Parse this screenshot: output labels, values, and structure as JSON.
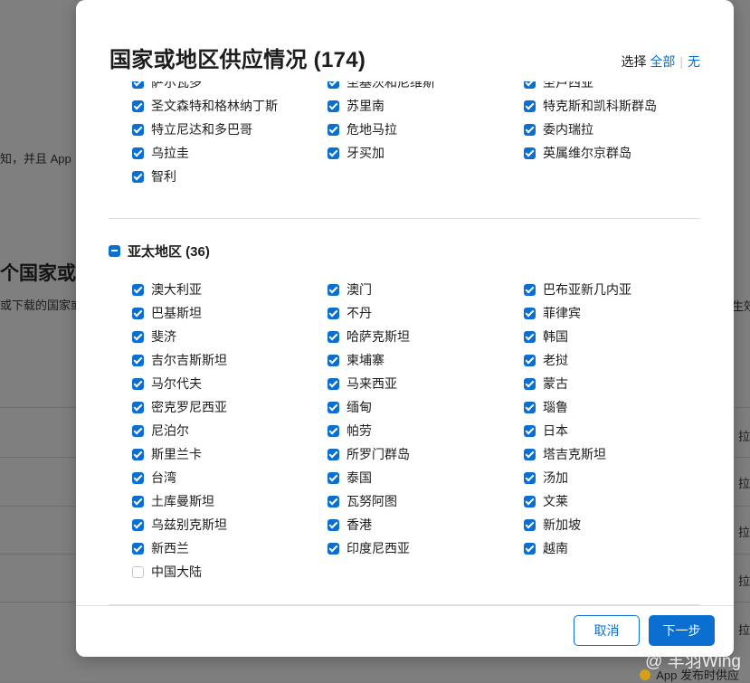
{
  "background": {
    "texts": {
      "notify": "知，并且 App",
      "heading": "个国家或地",
      "download": "或下载的国家或",
      "right_partial": "生效",
      "right_btn": "拉"
    },
    "bottom_note": "App 发布时供应"
  },
  "modal": {
    "title": "国家或地区供应情况 (174)",
    "select_label": "选择",
    "select_all": "全部",
    "select_none": "无",
    "top_list": [
      {
        "label": "萨尔瓦多",
        "checked": true
      },
      {
        "label": "圣基茨和尼维斯",
        "checked": true
      },
      {
        "label": "圣卢西亚",
        "checked": true
      },
      {
        "label": "圣文森特和格林纳丁斯",
        "checked": true
      },
      {
        "label": "苏里南",
        "checked": true
      },
      {
        "label": "特克斯和凯科斯群岛",
        "checked": true
      },
      {
        "label": "特立尼达和多巴哥",
        "checked": true
      },
      {
        "label": "危地马拉",
        "checked": true
      },
      {
        "label": "委内瑞拉",
        "checked": true
      },
      {
        "label": "乌拉圭",
        "checked": true
      },
      {
        "label": "牙买加",
        "checked": true
      },
      {
        "label": "英属维尔京群岛",
        "checked": true
      },
      {
        "label": "智利",
        "checked": true
      }
    ],
    "region": {
      "label": "亚太地区 (36)",
      "items": [
        {
          "label": "澳大利亚",
          "checked": true
        },
        {
          "label": "澳门",
          "checked": true
        },
        {
          "label": "巴布亚新几内亚",
          "checked": true
        },
        {
          "label": "巴基斯坦",
          "checked": true
        },
        {
          "label": "不丹",
          "checked": true
        },
        {
          "label": "菲律宾",
          "checked": true
        },
        {
          "label": "斐济",
          "checked": true
        },
        {
          "label": "哈萨克斯坦",
          "checked": true
        },
        {
          "label": "韩国",
          "checked": true
        },
        {
          "label": "吉尔吉斯斯坦",
          "checked": true
        },
        {
          "label": "柬埔寨",
          "checked": true
        },
        {
          "label": "老挝",
          "checked": true
        },
        {
          "label": "马尔代夫",
          "checked": true
        },
        {
          "label": "马来西亚",
          "checked": true
        },
        {
          "label": "蒙古",
          "checked": true
        },
        {
          "label": "密克罗尼西亚",
          "checked": true
        },
        {
          "label": "缅甸",
          "checked": true
        },
        {
          "label": "瑙鲁",
          "checked": true
        },
        {
          "label": "尼泊尔",
          "checked": true
        },
        {
          "label": "帕劳",
          "checked": true
        },
        {
          "label": "日本",
          "checked": true
        },
        {
          "label": "斯里兰卡",
          "checked": true
        },
        {
          "label": "所罗门群岛",
          "checked": true
        },
        {
          "label": "塔吉克斯坦",
          "checked": true
        },
        {
          "label": "台湾",
          "checked": true
        },
        {
          "label": "泰国",
          "checked": true
        },
        {
          "label": "汤加",
          "checked": true
        },
        {
          "label": "土库曼斯坦",
          "checked": true
        },
        {
          "label": "瓦努阿图",
          "checked": true
        },
        {
          "label": "文莱",
          "checked": true
        },
        {
          "label": "乌兹别克斯坦",
          "checked": true
        },
        {
          "label": "香港",
          "checked": true
        },
        {
          "label": "新加坡",
          "checked": true
        },
        {
          "label": "新西兰",
          "checked": true
        },
        {
          "label": "印度尼西亚",
          "checked": true
        },
        {
          "label": "越南",
          "checked": true
        },
        {
          "label": "中国大陆",
          "checked": false
        }
      ]
    },
    "footer": {
      "cancel": "取消",
      "next": "下一步"
    }
  },
  "watermark": "@ 羊羽Wing",
  "colors": {
    "accent": "#0a6fd1",
    "overlay": "#7f7f7f"
  }
}
